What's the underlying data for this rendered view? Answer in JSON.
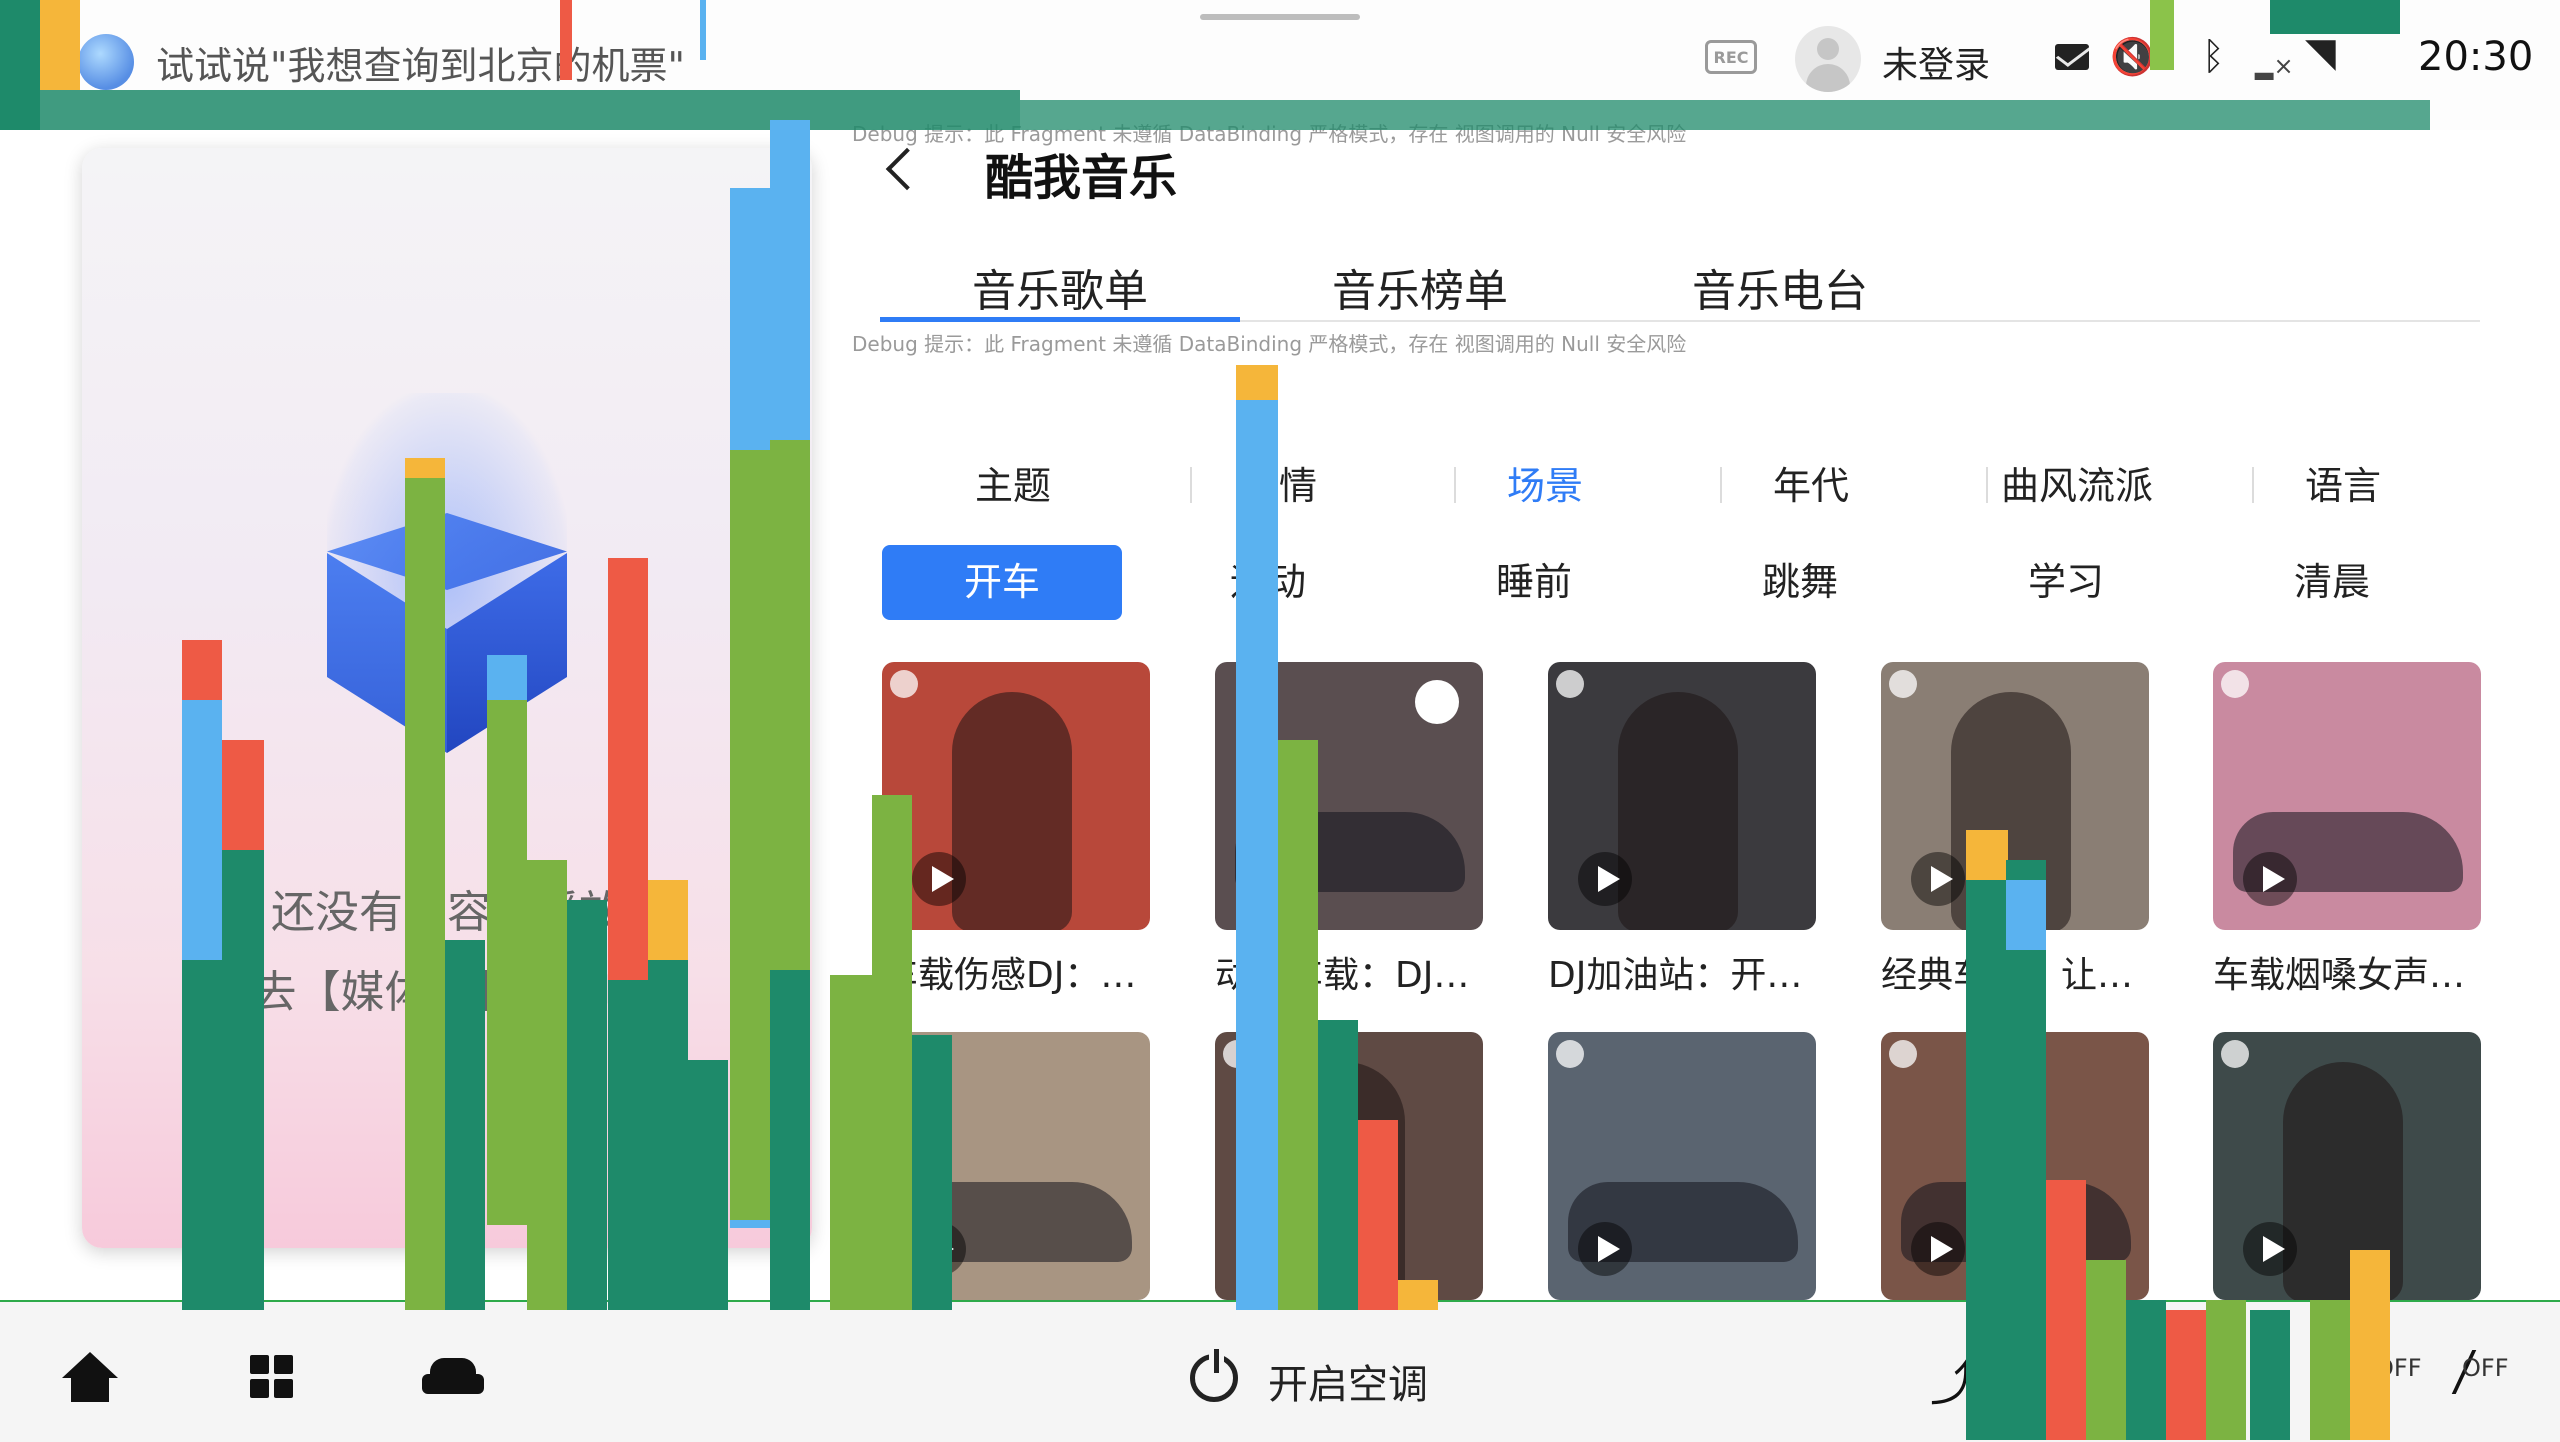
{
  "status_bar": {
    "voice_hint": "试试说\"我想查询到北京的机票\"",
    "rec_label": "REC",
    "login_label": "未登录",
    "time": "20:30",
    "icons": [
      "voice-assistant-icon",
      "rec-icon",
      "avatar",
      "mail-icon",
      "mute-icon",
      "bluetooth-icon",
      "signal-icon",
      "wifi-icon"
    ]
  },
  "debug": {
    "line1": "Debug 提示：此 Fragment 未遵循 DataBinding 严格模式，存在 视图调用的 Null 安全风险",
    "line2": "Debug 提示：此 Fragment 未遵循 DataBinding 严格模式，存在 视图调用的 Null 安全风险"
  },
  "media_card": {
    "empty_line1": "还没有内容在播放",
    "empty_line2": "快去【媒体库】找找吧~"
  },
  "music": {
    "title": "酷我音乐",
    "main_tabs": [
      {
        "label": "音乐歌单",
        "active": true
      },
      {
        "label": "音乐榜单",
        "active": false
      },
      {
        "label": "音乐电台",
        "active": false
      }
    ],
    "categories": [
      {
        "label": "主题",
        "active": false
      },
      {
        "label": "心情",
        "active": false
      },
      {
        "label": "场景",
        "active": true
      },
      {
        "label": "年代",
        "active": false
      },
      {
        "label": "曲风流派",
        "active": false
      },
      {
        "label": "语言",
        "active": false
      }
    ],
    "subcategories": [
      {
        "label": "开车",
        "active": true
      },
      {
        "label": "运动",
        "active": false
      },
      {
        "label": "睡前",
        "active": false
      },
      {
        "label": "跳舞",
        "active": false
      },
      {
        "label": "学习",
        "active": false
      },
      {
        "label": "清晨",
        "active": false
      }
    ],
    "playlists": [
      {
        "title": "车载伤感DJ：…",
        "bg": "#b8483a",
        "badge": "brand-icon"
      },
      {
        "title": "动力车载：DJ…",
        "bg": "#5a4e50",
        "badge": "tiktok-icon"
      },
      {
        "title": "DJ加油站：开…",
        "bg": "#3b3a3e",
        "badge": "brand-icon"
      },
      {
        "title": "经典车载：让…",
        "bg": "#8a7e74",
        "badge": "brand-icon"
      },
      {
        "title": "车载烟嗓女声…",
        "bg": "#c98aa0",
        "badge": "brand-icon"
      },
      {
        "title": "",
        "bg": "#a89582",
        "badge": "brand-icon"
      },
      {
        "title": "",
        "bg": "#5f4a44",
        "badge": "brand-icon"
      },
      {
        "title": "",
        "bg": "#5a6470",
        "badge": "brand-icon"
      },
      {
        "title": "",
        "bg": "#7a5548",
        "badge": "brand-icon"
      },
      {
        "title": "",
        "bg": "#3e4a4a",
        "badge": "brand-icon"
      }
    ]
  },
  "dock": {
    "ac_label": "开启空调",
    "off_left": "OFF",
    "off_right": "OFF",
    "icons": [
      "home-icon",
      "apps-grid-icon",
      "car-icon",
      "power-icon",
      "seat-icon",
      "car-outline-icon",
      "wiper-icon"
    ]
  }
}
